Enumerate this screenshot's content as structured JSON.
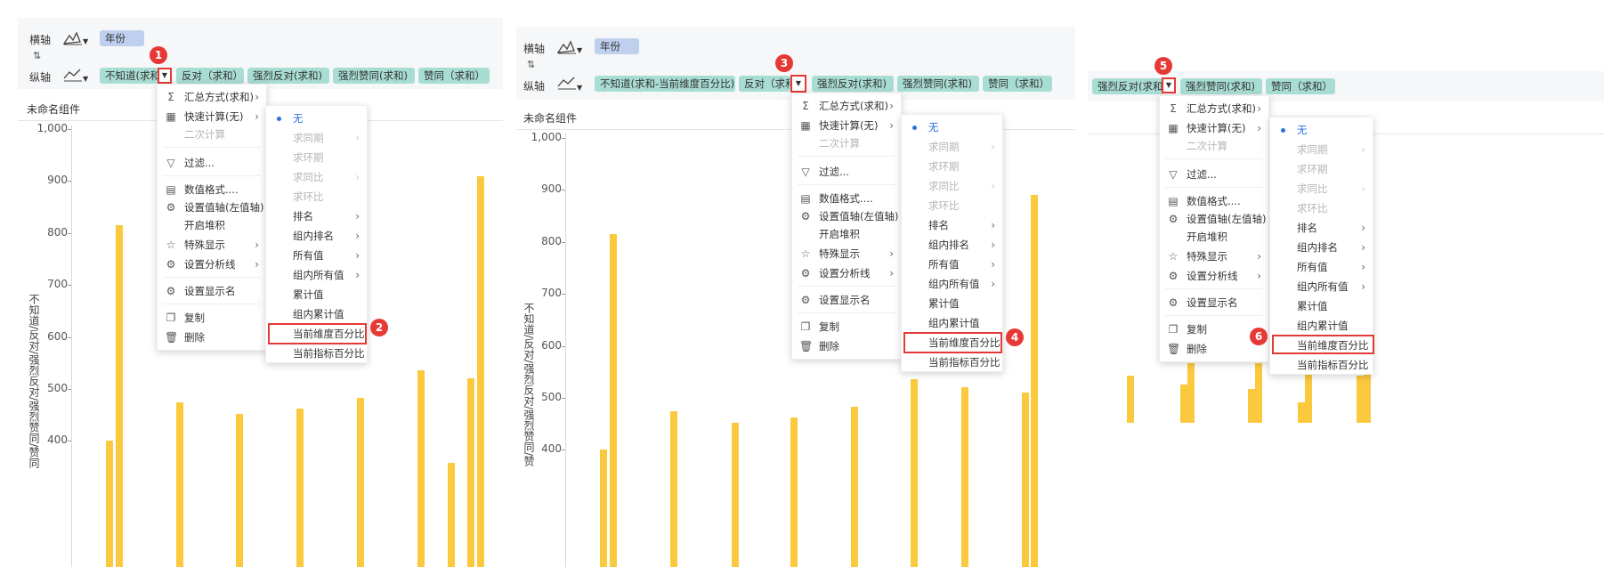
{
  "axis": {
    "x_label": "横轴",
    "y_label": "纵轴",
    "swap_icon": "swap-icon",
    "chart_type_icon": "area-chart-icon",
    "line_icon": "line-chart-icon"
  },
  "x_field": "年份",
  "panel1": {
    "y_fields": [
      "不知道(求和)",
      "反对（求和）",
      "强烈反对(求和)",
      "强烈赞同(求和)",
      "赞同（求和）"
    ],
    "title": "未命名组件",
    "y_axis_title": "不知道/反对/强烈反对/强烈赞同/赞同",
    "y_ticks": [
      "1,000",
      "900",
      "800",
      "700",
      "600",
      "500",
      "400"
    ]
  },
  "panel2": {
    "y_fields": [
      "不知道(求和-当前维度百分比)",
      "反对（求和",
      "强烈反对(求和)",
      "强烈赞同(求和)",
      "赞同（求和）"
    ],
    "title": "未命名组件",
    "y_axis_title": "不知道/反对/强烈反对/强烈赞同/赞",
    "y_ticks": [
      "1,000",
      "900",
      "800",
      "700",
      "600",
      "500",
      "400"
    ]
  },
  "panel3": {
    "y_fields": [
      "强烈反对(求和",
      "强烈赞同(求和)",
      "赞同（求和）"
    ]
  },
  "menu": {
    "items": [
      "汇总方式(求和)",
      "快速计算(无)",
      "二次计算",
      "过滤...",
      "数值格式....",
      "设置值轴(左值轴)",
      "开启堆积",
      "特殊显示",
      "设置分析线",
      "设置显示名",
      "复制",
      "删除"
    ]
  },
  "submenu": {
    "items": [
      "无",
      "求同期",
      "求环期",
      "求同比",
      "求环比",
      "排名",
      "组内排名",
      "所有值",
      "组内所有值",
      "累计值",
      "组内累计值",
      "当前维度百分比",
      "当前指标百分比"
    ]
  },
  "badges": [
    "1",
    "2",
    "3",
    "4",
    "5",
    "6"
  ],
  "colors": {
    "bar": "#fbc93d",
    "highlight": "#e53935",
    "field_blue": "#bfd0ef",
    "field_teal": "#a8ddd3"
  },
  "chart_data": {
    "type": "bar",
    "ylim": [
      300,
      1000
    ],
    "y_ticks": [
      1000,
      900,
      800,
      700,
      600,
      500,
      400
    ],
    "values_panel1": [
      400,
      815,
      475,
      452,
      462,
      482,
      535,
      357,
      520,
      910
    ],
    "values_panel2": [
      400,
      815,
      475,
      452,
      462,
      482,
      535,
      520,
      510,
      890
    ]
  }
}
